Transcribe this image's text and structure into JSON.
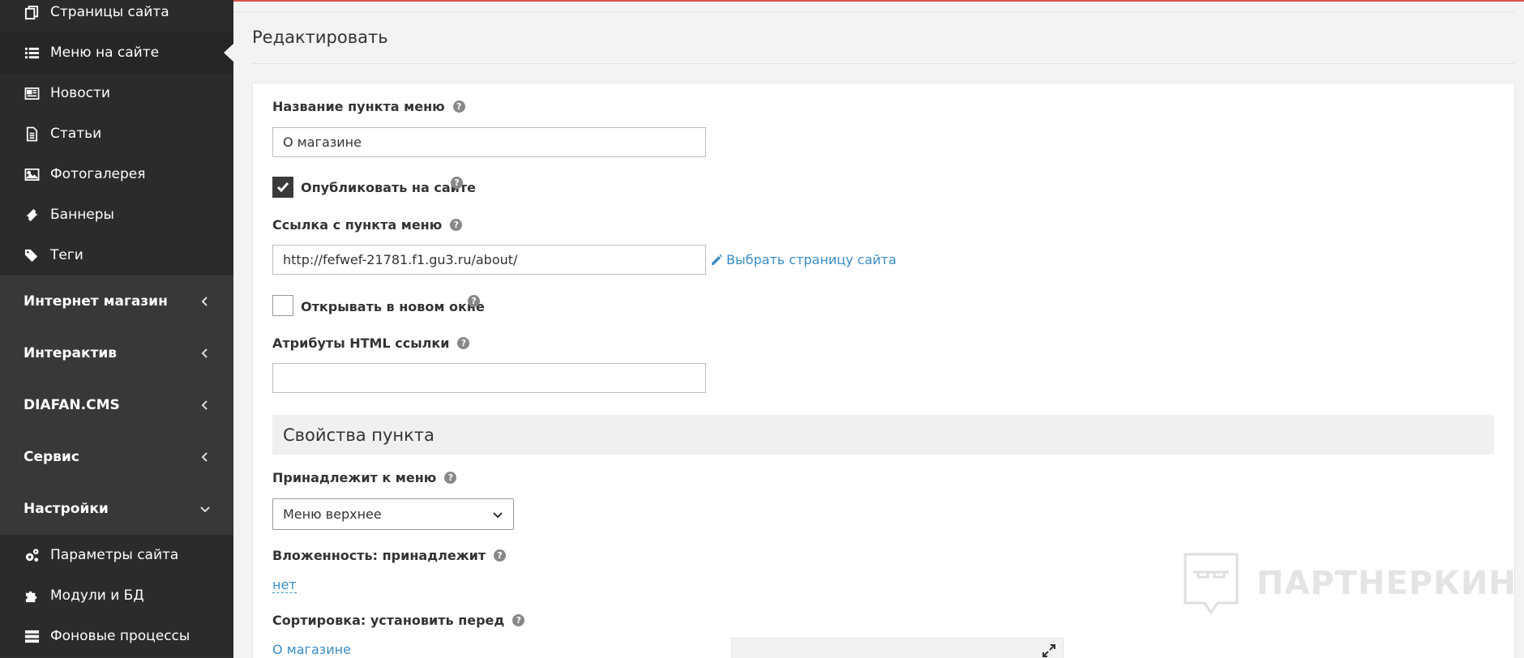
{
  "sidebar": {
    "items": [
      {
        "label": "Страницы сайта",
        "icon": "pages-icon"
      },
      {
        "label": "Меню на сайте",
        "icon": "list-icon"
      },
      {
        "label": "Новости",
        "icon": "newspaper-icon"
      },
      {
        "label": "Статьи",
        "icon": "document-icon"
      },
      {
        "label": "Фотогалерея",
        "icon": "image-icon"
      },
      {
        "label": "Баннеры",
        "icon": "ticket-icon"
      },
      {
        "label": "Теги",
        "icon": "tags-icon"
      }
    ],
    "groups": [
      {
        "label": "Интернет магазин"
      },
      {
        "label": "Интерактив"
      },
      {
        "label": "DIAFAN.CMS"
      },
      {
        "label": "Сервис"
      },
      {
        "label": "Настройки"
      }
    ],
    "settings_items": [
      {
        "label": "Параметры сайта",
        "icon": "cogs-icon"
      },
      {
        "label": "Модули и БД",
        "icon": "puzzle-icon"
      },
      {
        "label": "Фоновые процессы",
        "icon": "server-icon"
      }
    ]
  },
  "page": {
    "title": "Редактировать"
  },
  "form": {
    "name_label": "Название пункта меню",
    "name_value": "О магазине",
    "publish_label": "Опубликовать на сайте",
    "link_label": "Ссылка с пункта меню",
    "link_value": "http://fefwef-21781.f1.gu3.ru/about/",
    "choose_page": "Выбрать страницу сайта",
    "new_window_label": "Открывать в новом окне",
    "attrs_label": "Атрибуты HTML ссылки",
    "attrs_value": "",
    "section_title": "Свойства пункта",
    "menu_label": "Принадлежит к меню",
    "menu_value": "Меню верхнее",
    "parent_label": "Вложенность: принадлежит",
    "parent_value": "нет",
    "sort_label": "Сортировка: установить перед",
    "sort_value": "О магазине",
    "help_glyph": "?"
  },
  "watermark": {
    "text": "ПАРТНЕРКИН"
  },
  "colors": {
    "accent": "#3a8dc7",
    "sidebar": "#2e2e2e",
    "topline": "#d9534f"
  }
}
